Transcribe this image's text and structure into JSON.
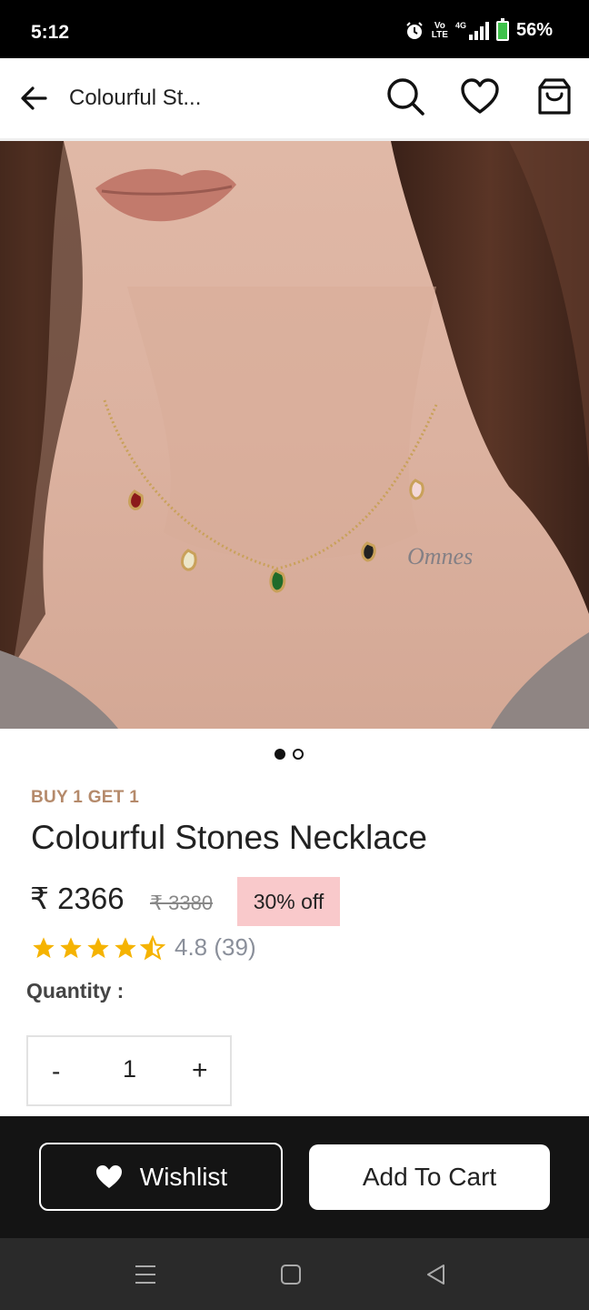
{
  "status_bar": {
    "time": "5:12",
    "network_top": "Vo",
    "network_bottom": "LTE",
    "network_type": "4G",
    "battery": "56%",
    "icons": [
      "alarm-icon",
      "volte-icon",
      "signal-icon",
      "battery-charging-icon"
    ]
  },
  "app_bar": {
    "title": "Colourful St...",
    "icons": [
      "back-arrow-icon",
      "search-icon",
      "heart-icon",
      "shopping-bag-icon"
    ]
  },
  "gallery": {
    "total_images": 2,
    "current_index": 1
  },
  "product": {
    "promo": "BUY 1 GET 1",
    "name": "Colourful Stones Necklace",
    "price": "₹ 2366",
    "mrp": "₹ 3380",
    "discount": "30% off",
    "rating_value": 4.8,
    "rating_text": "4.8 (39)",
    "quantity_label": "Quantity :",
    "quantity_minus": "-",
    "quantity_value": "1",
    "quantity_plus": "+"
  },
  "actions": {
    "wishlist_label": "Wishlist",
    "add_to_cart_label": "Add To Cart"
  },
  "colors": {
    "accent_promo": "#b58a6b",
    "discount_bg": "#f9c9cb",
    "star": "#f5b301",
    "bottom_bar": "#141414"
  }
}
